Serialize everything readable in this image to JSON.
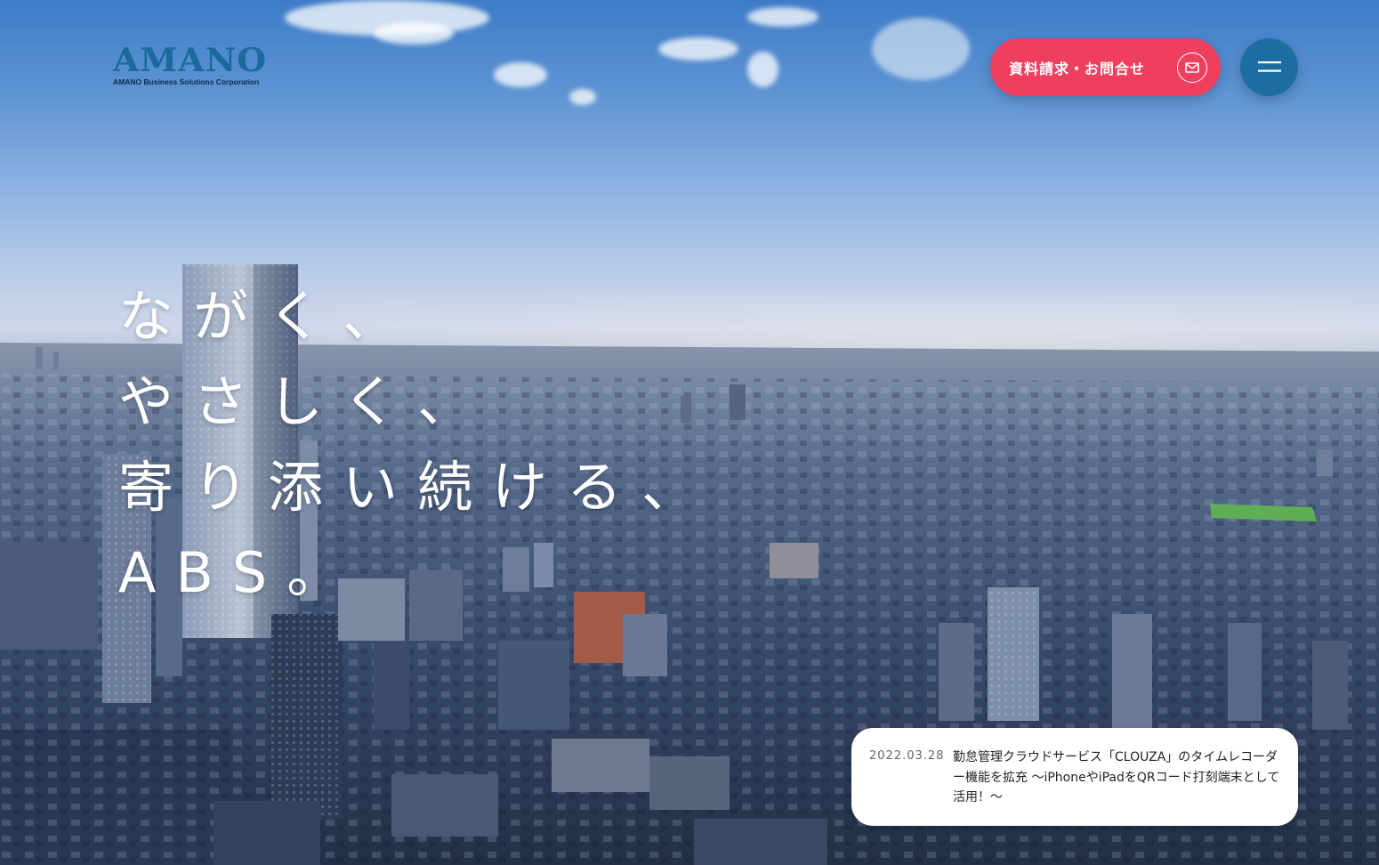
{
  "header": {
    "logo_text": "AMANO",
    "logo_subtext": "AMANO Business Solutions Corporation",
    "contact_button_label": "資料請求・お問合せ",
    "contact_icon": "mail-icon",
    "menu_icon": "hamburger-menu-icon"
  },
  "hero": {
    "tagline_lines": [
      "ながく、",
      "やさしく、",
      "寄り添い続ける、",
      "ABS。"
    ]
  },
  "news": {
    "date": "2022.03.28",
    "title": "勤怠管理クラウドサービス「CLOUZA」のタイムレコーダー機能を拡充 〜iPhoneやiPadをQRコード打刻端末として活用！〜"
  },
  "colors": {
    "brand_blue": "#1a6a9c",
    "contact_pink": "#ef3f5f",
    "menu_blue": "#1f6ea3"
  }
}
